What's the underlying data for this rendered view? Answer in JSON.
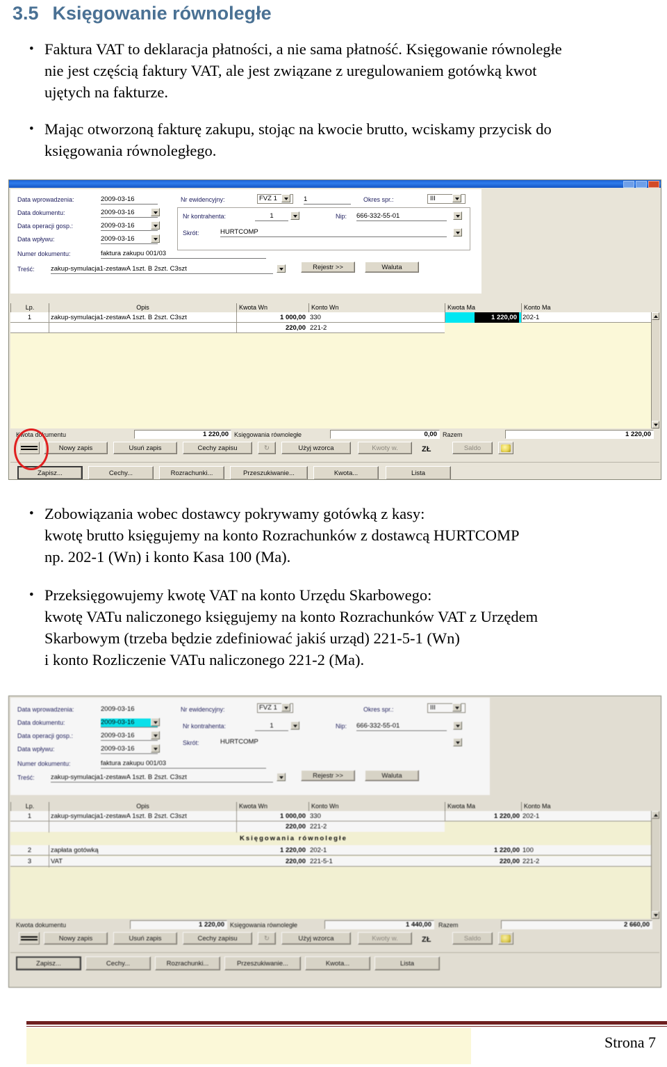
{
  "document": {
    "heading": {
      "number": "3.5",
      "title": "Księgowanie równoległe"
    },
    "bullets": [
      {
        "lines": [
          "Faktura VAT to deklaracja płatności, a nie sama płatność. Księgowanie równoległe",
          "nie jest częścią faktury VAT, ale jest związane z uregulowaniem gotówką kwot",
          "ujętych na fakturze."
        ]
      },
      {
        "lines": [
          "Mając otworzoną fakturę zakupu, stojąc na kwocie brutto, wciskamy przycisk do",
          "księgowania równoległego."
        ]
      },
      {
        "lines": [
          "Zobowiązania wobec dostawcy pokrywamy gotówką z kasy:",
          "kwotę brutto księgujemy na konto Rozrachunków z dostawcą HURTCOMP",
          "np. 202-1 (Wn) i konto Kasa 100 (Ma)."
        ]
      },
      {
        "lines": [
          "Przeksięgowujemy kwotę VAT na konto Urzędu Skarbowego:",
          "kwotę VATu naliczonego księgujemy na konto Rozrachunków VAT z Urzędem",
          "Skarbowym (trzeba będzie zdefiniować jakiś urząd) 221-5-1 (Wn)",
          "i konto Rozliczenie VATu naliczonego 221-2 (Ma)."
        ]
      }
    ],
    "footer": {
      "page_label": "Strona 7"
    }
  },
  "screenshot1": {
    "form": {
      "fields": [
        {
          "label": "Data wprowadzenia:",
          "value": "2009-03-16",
          "combo": false
        },
        {
          "label": "Data dokumentu:",
          "value": "2009-03-16",
          "combo": true
        },
        {
          "label": "Data operacji gosp.:",
          "value": "2009-03-16",
          "combo": true
        },
        {
          "label": "Data wpływu:",
          "value": "2009-03-16",
          "combo": true
        }
      ],
      "doc_number_label": "Numer dokumentu:",
      "doc_number_value": "faktura zakupu 001/03",
      "content_label": "Treść:",
      "content_value": "zakup-symulacja1-zestawA 1szt. B 2szt. C3szt",
      "reg_label": "Nr ewidencyjny:",
      "reg_type": "FVZ   1",
      "reg_number": "1",
      "period_label": "Okres spr.:",
      "period_value": "III",
      "contractor_label": "Nr kontrahenta:",
      "contractor_value": "1",
      "nip_label": "Nip:",
      "nip_value": "666-332-55-01",
      "short_label": "Skrót:",
      "short_value": "HURTCOMP",
      "btn_register": "Rejestr >>",
      "btn_currency": "Waluta"
    },
    "grid": {
      "headers": [
        "Lp.",
        "Opis",
        "Kwota Wn",
        "Konto Wn",
        "Kwota Ma",
        "Konto Ma"
      ],
      "rows": [
        {
          "lp": "1",
          "opis": "zakup-symulacja1-zestawA 1szt. B 2szt. C3szt",
          "kwota_wn": "1 000,00",
          "konto_wn": "330",
          "kwota_ma": "1 220,00",
          "konto_ma": "202-1",
          "selected": true
        },
        {
          "lp": "",
          "opis": "",
          "kwota_wn": "220,00",
          "konto_wn": "221-2",
          "kwota_ma": "",
          "konto_ma": "",
          "selected": false
        }
      ]
    },
    "status": {
      "doc_amount_label": "Kwota dokumentu",
      "doc_amount_value": "1 220,00",
      "parallel_label": "Księgowania równoległe",
      "parallel_value": "0,00",
      "total_label": "Razem",
      "total_value": "1 220,00"
    },
    "toolbar": {
      "buttons": [
        "Nowy zapis",
        "Usuń zapis",
        "Cechy zapisu"
      ],
      "template_button": "Użyj wzorca",
      "amounts_button": "Kwoty w.",
      "currency_code": "ZŁ",
      "balance_button": "Saldo"
    },
    "bottombar": {
      "buttons": [
        "Zapisz...",
        "Cechy...",
        "Rozrachunki...",
        "Przeszukiwanie...",
        "Kwota...",
        "Lista"
      ]
    }
  },
  "screenshot2": {
    "form": {
      "fields": [
        {
          "label": "Data wprowadzenia:",
          "value": "2009-03-16",
          "combo": false,
          "highlight": false
        },
        {
          "label": "Data dokumentu:",
          "value": "2009-03-16",
          "combo": true,
          "highlight": true
        },
        {
          "label": "Data operacji gosp.:",
          "value": "2009-03-16",
          "combo": true,
          "highlight": false
        },
        {
          "label": "Data wpływu:",
          "value": "2009-03-16",
          "combo": true,
          "highlight": false
        }
      ],
      "doc_number_label": "Numer dokumentu:",
      "doc_number_value": "faktura zakupu 001/03",
      "content_label": "Treść:",
      "content_value": "zakup-symulacja1-zestawA 1szt. B 2szt. C3szt",
      "reg_label": "Nr ewidencyjny:",
      "reg_type": "FVZ   1",
      "period_label": "Okres spr.:",
      "period_value": "III",
      "contractor_label": "Nr kontrahenta:",
      "contractor_value": "1",
      "nip_label": "Nip:",
      "nip_value": "666-332-55-01",
      "short_label": "Skrót:",
      "short_value": "HURTCOMP",
      "btn_register": "Rejestr >>",
      "btn_currency": "Waluta"
    },
    "grid": {
      "headers": [
        "Lp.",
        "Opis",
        "Kwota Wn",
        "Konto Wn",
        "Kwota Ma",
        "Konto Ma"
      ],
      "separator_label": "Księgowania równoległe",
      "rows": [
        {
          "lp": "1",
          "opis": "zakup-symulacja1-zestawA 1szt. B 2szt. C3szt",
          "kwota_wn": "1 000,00",
          "konto_wn": "330",
          "kwota_ma": "1 220,00",
          "konto_ma": "202-1"
        },
        {
          "lp": "",
          "opis": "",
          "kwota_wn": "220,00",
          "konto_wn": "221-2",
          "kwota_ma": "",
          "konto_ma": ""
        },
        {
          "lp": "2",
          "opis": "zapłata gotówką",
          "kwota_wn": "1 220,00",
          "konto_wn": "202-1",
          "kwota_ma": "1 220,00",
          "konto_ma": "100"
        },
        {
          "lp": "3",
          "opis": "VAT",
          "kwota_wn": "220,00",
          "konto_wn": "221-5-1",
          "kwota_ma": "220,00",
          "konto_ma": "221-2"
        }
      ]
    },
    "status": {
      "doc_amount_label": "Kwota dokumentu",
      "doc_amount_value": "1 220,00",
      "parallel_label": "Księgowania równoległe",
      "parallel_value": "1 440,00",
      "total_label": "Razem",
      "total_value": "2 660,00"
    },
    "toolbar": {
      "buttons": [
        "Nowy zapis",
        "Usuń zapis",
        "Cechy zapisu"
      ],
      "template_button": "Użyj wzorca",
      "amounts_button": "Kwoty w.",
      "currency_code": "ZŁ",
      "balance_button": "Saldo"
    },
    "bottombar": {
      "buttons": [
        "Zapisz...",
        "Cechy...",
        "Rozrachunki...",
        "Przeszukiwanie...",
        "Kwota...",
        "Lista"
      ]
    }
  }
}
